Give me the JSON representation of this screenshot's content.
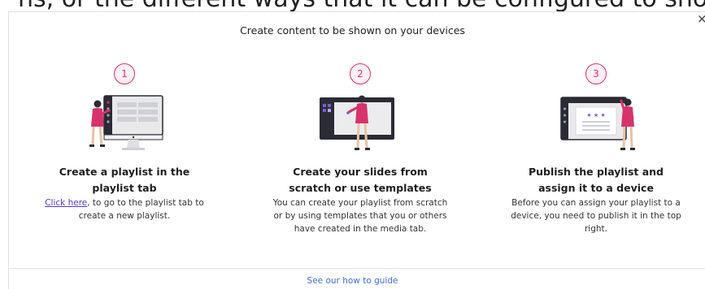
{
  "banner": {
    "text": "ns, or the different ways that it can be configured to show on a single screen. Start by selecting a layou"
  },
  "modal": {
    "title": "Create content to be shown on your devices",
    "close_symbol": "×",
    "footer_link": "See our how to guide"
  },
  "steps": [
    {
      "number": "1",
      "title_line1": "Create a playlist in the",
      "title_line2": "playlist tab",
      "link_text": "Click here",
      "desc": ", to go to the playlist tab to create a new playlist."
    },
    {
      "number": "2",
      "title_line1": "Create your slides from",
      "title_line2": "scratch or use templates",
      "desc": "You can create your playlist from scratch or by using templates that you or others have created in the media tab."
    },
    {
      "number": "3",
      "title_line1": "Publish the playlist and",
      "title_line2": "assign it to a device",
      "desc": "Before you can assign your playlist to a device, you need to publish it in the top right."
    }
  ],
  "colors": {
    "accent": "#d6336c",
    "link": "#4a3bd6",
    "footer_link": "#3c6fd8"
  }
}
